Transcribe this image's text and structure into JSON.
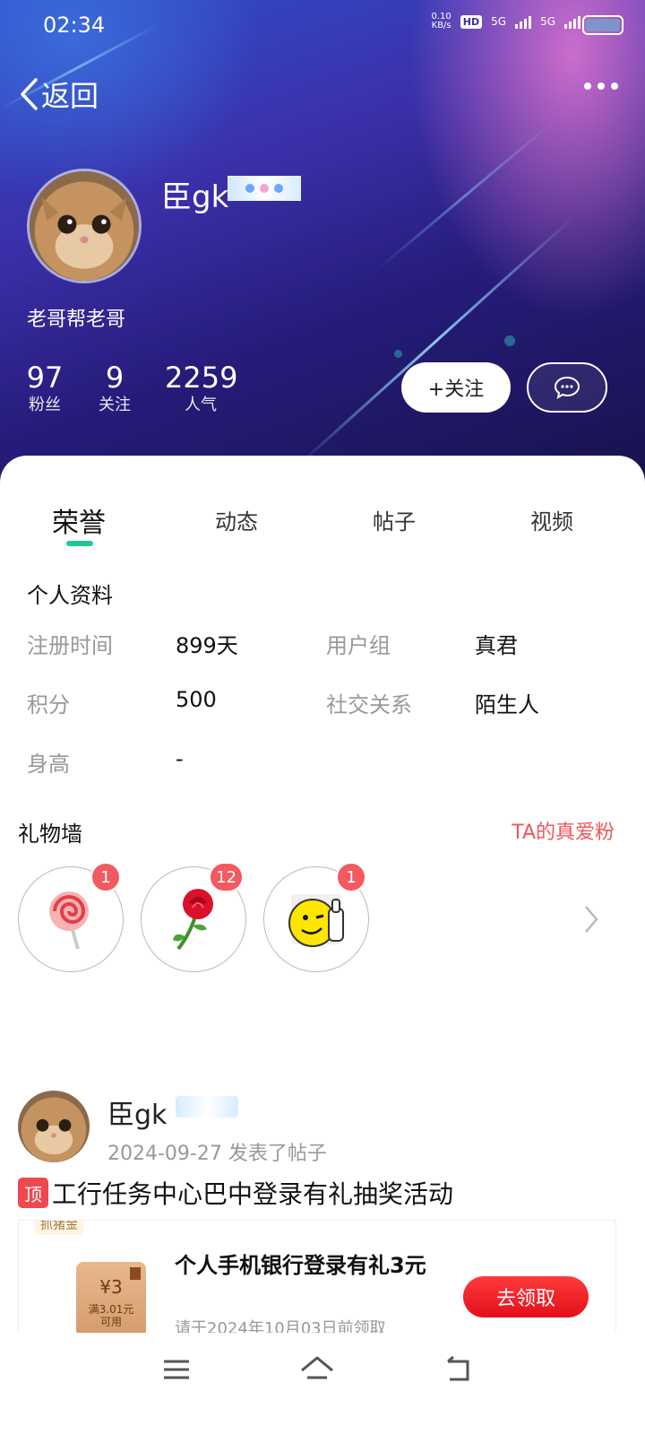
{
  "status_bar": {
    "time": "02:34",
    "net_speed_value": "0.10",
    "net_speed_unit": "KB/s",
    "hd_label": "HD",
    "sim1_label": "5G",
    "sim2_label": "5G"
  },
  "header": {
    "back_label": "返回",
    "username": "臣gk",
    "motto": "老哥帮老哥",
    "stats": [
      {
        "value": "97",
        "label": "粉丝"
      },
      {
        "value": "9",
        "label": "关注"
      },
      {
        "value": "2259",
        "label": "人气"
      }
    ],
    "follow_label": "+关注"
  },
  "tabs": [
    {
      "label": "荣誉",
      "active": true
    },
    {
      "label": "动态",
      "active": false
    },
    {
      "label": "帖子",
      "active": false
    },
    {
      "label": "视频",
      "active": false
    }
  ],
  "profile": {
    "title": "个人资料",
    "fields": [
      {
        "label": "注册时间",
        "value": "899天"
      },
      {
        "label": "用户组",
        "value": "真君"
      },
      {
        "label": "积分",
        "value": "500"
      },
      {
        "label": "社交关系",
        "value": "陌生人"
      },
      {
        "label": "身高",
        "value": "-"
      }
    ]
  },
  "gifts": {
    "title": "礼物墙",
    "fans_link": "TA的真爱粉",
    "items": [
      {
        "icon": "lollipop-icon",
        "count": "1"
      },
      {
        "icon": "rose-icon",
        "count": "12"
      },
      {
        "icon": "thumbs-up-smiley-icon",
        "count": "1"
      }
    ]
  },
  "post": {
    "username": "臣gk",
    "meta": "2024-09-27 发表了帖子",
    "top_tag": "顶",
    "title": "工行任务中心巴中登录有礼抽奖活动",
    "promo": {
      "strip_label": "抓猪金",
      "coupon_value": "¥3",
      "coupon_sub1": "满3.01元",
      "coupon_sub2": "可用",
      "title": "个人手机银行登录有礼3元",
      "subtitle": "请于2024年10月03日前领取",
      "claim_label": "去领取"
    }
  },
  "colors": {
    "accent_green": "#1ec79a",
    "badge_red": "#f25a5f",
    "link_red": "#f0565a",
    "claim_red": "#e30f1a"
  }
}
